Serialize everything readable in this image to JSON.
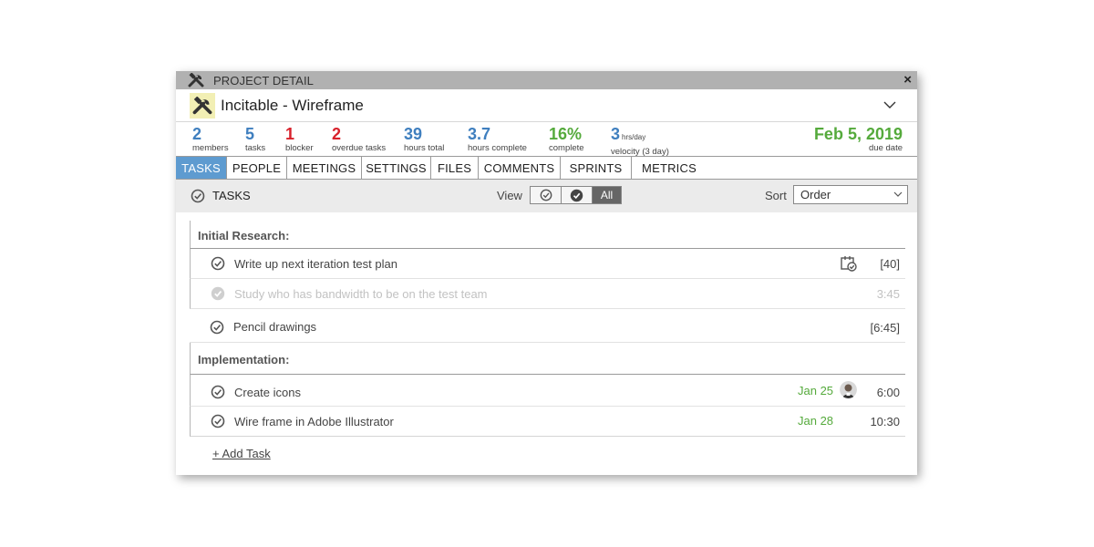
{
  "window": {
    "title": "PROJECT DETAIL",
    "close_label": "×"
  },
  "project": {
    "name": "Incitable - Wireframe"
  },
  "stats": [
    {
      "value": "2",
      "label": "members",
      "color": "#3f7fbf"
    },
    {
      "value": "5",
      "label": "tasks",
      "color": "#3f7fbf"
    },
    {
      "value": "1",
      "label": "blocker",
      "color": "#d8212b"
    },
    {
      "value": "2",
      "label": "overdue tasks",
      "color": "#d8212b"
    },
    {
      "value": "39",
      "label": "hours total",
      "color": "#3f7fbf"
    },
    {
      "value": "3.7",
      "label": "hours complete",
      "color": "#3f7fbf"
    },
    {
      "value": "16%",
      "label": "complete",
      "color": "#55aa3c"
    },
    {
      "value": "3",
      "unit": "hrs/day",
      "label": "velocity (3 day)",
      "color": "#3f7fbf"
    }
  ],
  "due": {
    "value": "Feb 5, 2019",
    "label": "due date"
  },
  "tabs": [
    {
      "label": "TASKS",
      "active": true
    },
    {
      "label": "PEOPLE"
    },
    {
      "label": "MEETINGS"
    },
    {
      "label": "SETTINGS"
    },
    {
      "label": "FILES"
    },
    {
      "label": "COMMENTS"
    },
    {
      "label": "SPRINTS"
    },
    {
      "label": "METRICS"
    }
  ],
  "toolbar": {
    "title": "TASKS",
    "view_label": "View",
    "view_all": "All",
    "sort_label": "Sort",
    "sort_value": "Order"
  },
  "groups": [
    {
      "title": "Initial Research:",
      "tasks": [
        {
          "name": "Write up next iteration test plan",
          "time": "[40]",
          "icon": "calendar-check-icon"
        },
        {
          "name": "Study who has bandwidth to be on the test team",
          "time": "3:45",
          "completed": true
        },
        {
          "name": "Pencil drawings",
          "time": "[6:45]"
        }
      ]
    },
    {
      "title": "Implementation:",
      "tasks": [
        {
          "name": "Create icons",
          "date": "Jan 25",
          "time": "6:00",
          "icon": "avatar"
        },
        {
          "name": "Wire frame in Adobe Illustrator",
          "date": "Jan 28",
          "time": "10:30"
        }
      ]
    }
  ],
  "add_task": "+ Add Task"
}
